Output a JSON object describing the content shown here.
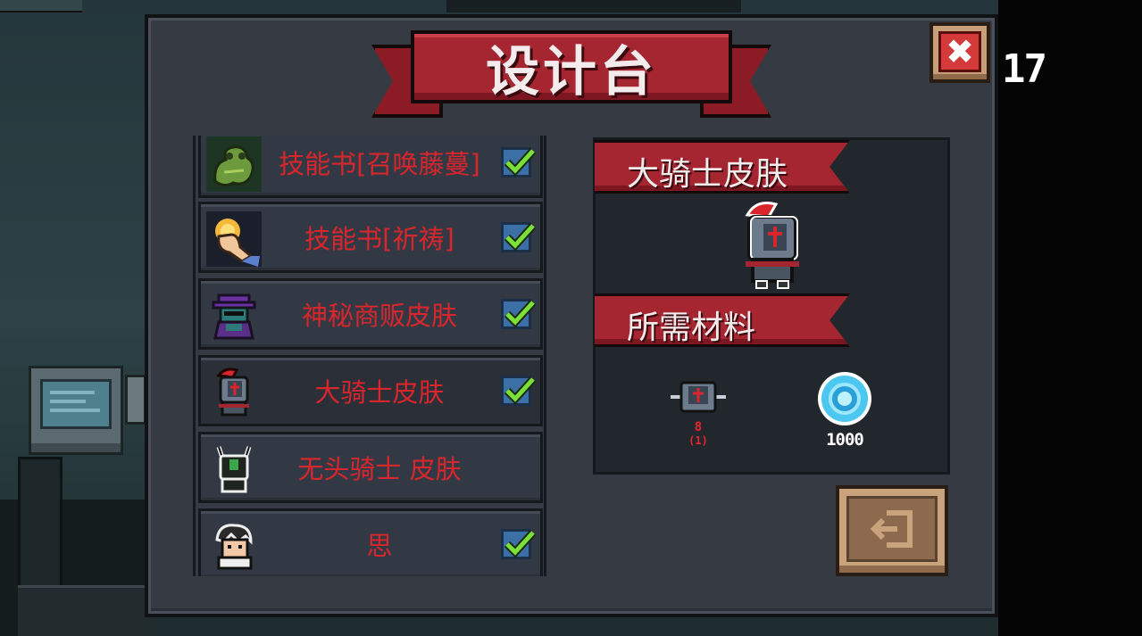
{
  "title": "设计台",
  "counter": "17",
  "close_label": "✖",
  "list": [
    {
      "name": "技能书[召唤藤蔓]",
      "icon": "vine-dragon-icon",
      "checked": true
    },
    {
      "name": "技能书[祈祷]",
      "icon": "praying-hand-icon",
      "checked": true
    },
    {
      "name": "神秘商贩皮肤",
      "icon": "mysterious-merchant-icon",
      "checked": true
    },
    {
      "name": "大骑士皮肤",
      "icon": "grand-knight-icon",
      "checked": true
    },
    {
      "name": "无头骑士 皮肤",
      "icon": "headless-knight-icon",
      "checked": false
    },
    {
      "name": "思",
      "icon": "character-si-icon",
      "checked": true
    }
  ],
  "selected": {
    "name": "大骑士皮肤",
    "materials_label": "所需材料",
    "materials": [
      {
        "icon": "knight-helmet-icon",
        "required": "8",
        "owned": "(1)"
      },
      {
        "icon": "blue-gem-icon",
        "amount": "1000"
      }
    ]
  },
  "colors": {
    "panel": "#353a43",
    "ribbon": "#a52631",
    "item_text": "#d8262c",
    "check_bg": "#3b6fa6",
    "check_mark": "#7be03a",
    "gem": "#4cc8f0"
  }
}
